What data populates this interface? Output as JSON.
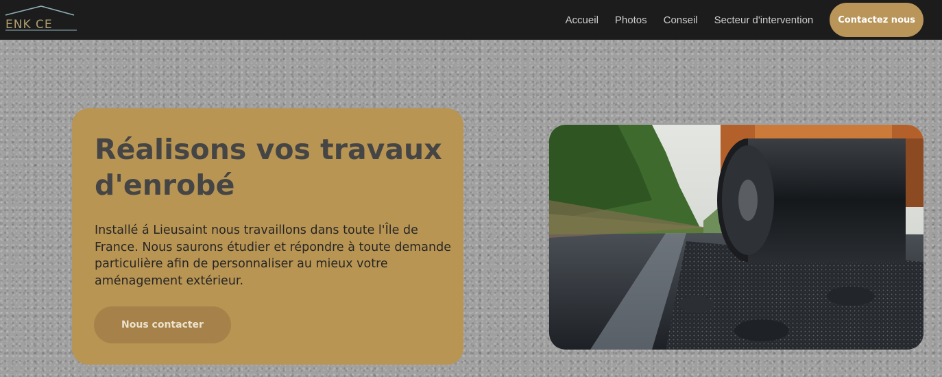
{
  "header": {
    "logo_text": "ENK CE",
    "nav": [
      "Accueil",
      "Photos",
      "Conseil",
      "Secteur d'intervention"
    ],
    "cta_label": "Contactez nous"
  },
  "hero": {
    "title": "Réalisons vos travaux d'enrobé",
    "text": "Installé á Lieusaint nous travaillons dans toute l'Île de France. Nous saurons étudier et répondre à toute demande particulière afin de personnaliser au mieux votre aménagement extérieur.",
    "button_label": "Nous contacter"
  },
  "colors": {
    "header_bg": "#1c1c1c",
    "accent": "#b9955a",
    "card_bg": "#b99553",
    "button_bg": "#a6824a"
  },
  "icons": {
    "logo": "house-roof-logo-icon"
  }
}
